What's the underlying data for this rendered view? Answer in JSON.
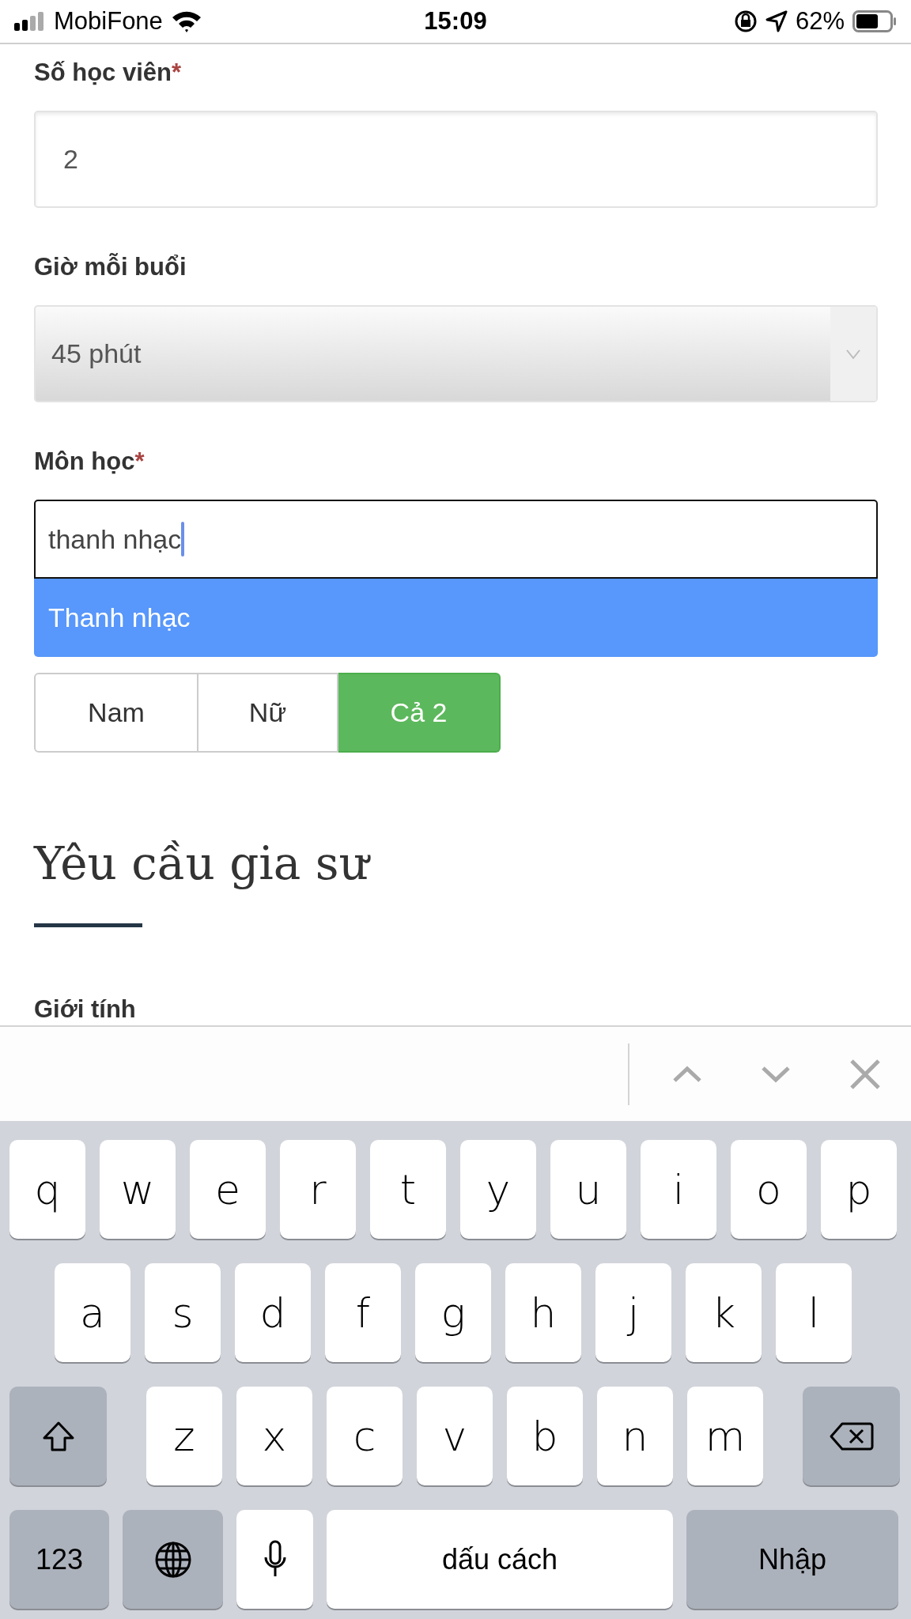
{
  "status_bar": {
    "carrier": "MobiFone",
    "time": "15:09",
    "battery": "62%"
  },
  "form": {
    "fields": [
      {
        "label": "Số học viên",
        "required_mark": "*",
        "kind": "input",
        "value": "2"
      },
      {
        "label": "Giờ mỗi buổi",
        "kind": "select",
        "value": "45 phút"
      },
      {
        "label": "Môn học",
        "required_mark": "*",
        "kind": "autocomplete",
        "value": "thanh nhạc",
        "suggestions": [
          {
            "label": "Thanh nhạc",
            "selected": true
          }
        ]
      }
    ],
    "gender_options": [
      {
        "label": "Nam",
        "selected": false
      },
      {
        "label": "Nữ",
        "selected": false
      },
      {
        "label": "Cả 2",
        "selected": true
      }
    ],
    "section_title": "Yêu cầu gia sư",
    "next_label": "Giới tính"
  },
  "keyboard": {
    "rows": [
      {
        "keys": [
          {
            "kind": "letter",
            "label": "q"
          },
          {
            "kind": "letter",
            "label": "w"
          },
          {
            "kind": "letter",
            "label": "e"
          },
          {
            "kind": "letter",
            "label": "r"
          },
          {
            "kind": "letter",
            "label": "t"
          },
          {
            "kind": "letter",
            "label": "y"
          },
          {
            "kind": "letter",
            "label": "u"
          },
          {
            "kind": "letter",
            "label": "i"
          },
          {
            "kind": "letter",
            "label": "o"
          },
          {
            "kind": "letter",
            "label": "p"
          }
        ]
      },
      {
        "keys": [
          {
            "kind": "letter",
            "label": "a"
          },
          {
            "kind": "letter",
            "label": "s"
          },
          {
            "kind": "letter",
            "label": "d"
          },
          {
            "kind": "letter",
            "label": "f"
          },
          {
            "kind": "letter",
            "label": "g"
          },
          {
            "kind": "letter",
            "label": "h"
          },
          {
            "kind": "letter",
            "label": "j"
          },
          {
            "kind": "letter",
            "label": "k"
          },
          {
            "kind": "letter",
            "label": "l"
          }
        ]
      },
      {
        "keys": [
          {
            "kind": "shift"
          },
          {
            "kind": "letter",
            "label": "z"
          },
          {
            "kind": "letter",
            "label": "x"
          },
          {
            "kind": "letter",
            "label": "c"
          },
          {
            "kind": "letter",
            "label": "v"
          },
          {
            "kind": "letter",
            "label": "b"
          },
          {
            "kind": "letter",
            "label": "n"
          },
          {
            "kind": "letter",
            "label": "m"
          },
          {
            "kind": "delete"
          }
        ]
      },
      {
        "keys": [
          {
            "kind": "numbers",
            "label": "123"
          },
          {
            "kind": "globe"
          },
          {
            "kind": "mic"
          },
          {
            "kind": "space",
            "label": "dấu cách"
          },
          {
            "kind": "return",
            "label": "Nhập"
          }
        ]
      }
    ]
  }
}
